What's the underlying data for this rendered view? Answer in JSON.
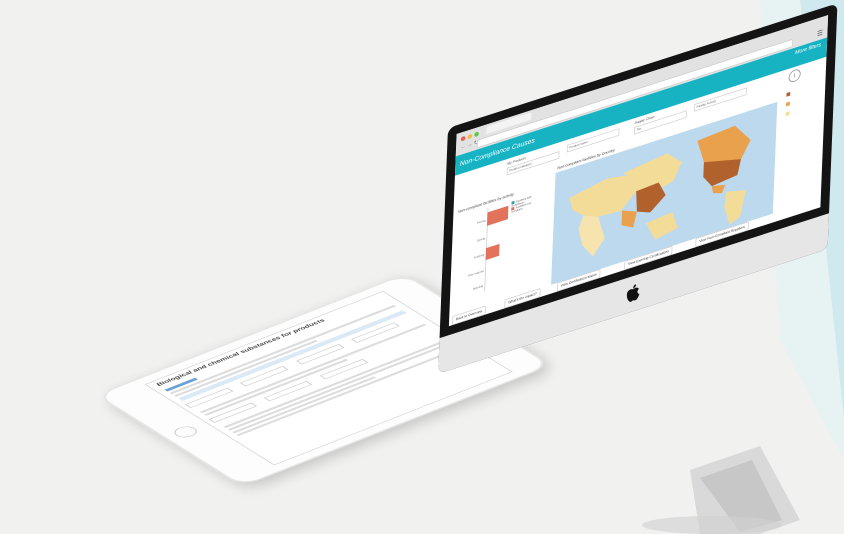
{
  "colors": {
    "accent_teal": "#18b3c2",
    "bar_fill": "#e2735a",
    "map_water": "#bcd9ee",
    "map_high": "#b0612c",
    "map_mid": "#e9a14e",
    "map_low": "#f3dc98",
    "page_background": "#f1f1f0"
  },
  "browser": {
    "back_icon": "back-arrow-icon",
    "forward_icon": "forward-arrow-icon",
    "reload_icon": "reload-icon",
    "menu_icon": "hamburger-menu-icon"
  },
  "app": {
    "title": "Non-Compliance Causes",
    "more_filters": "More filters"
  },
  "filters": [
    {
      "label": "My Products",
      "value": "Product category"
    },
    {
      "label": "",
      "value": "Product name"
    },
    {
      "label": "Supply Chain",
      "value": "Tier"
    },
    {
      "label": "",
      "value": "Facility Activity"
    }
  ],
  "left_panel": {
    "title": "Non-compliant facilities by activity"
  },
  "bar_chart": {
    "categories": [
      "Sewing",
      "Dyeing",
      "Finishing",
      "Raw material",
      "Spinning"
    ],
    "values": [
      48,
      0,
      0,
      32,
      0
    ]
  },
  "legend": [
    {
      "text": "Facilities with compliance",
      "color": "#2fa39a"
    },
    {
      "text": "Facilities non-compliant",
      "color": "#e2735a"
    }
  ],
  "map": {
    "title": "Non-compliant facilities by Country"
  },
  "actions": [
    {
      "label": "Back to Overview"
    },
    {
      "label": "What's the impact?"
    },
    {
      "label": "View Certification status"
    },
    {
      "label": "View Expiring Certifications"
    },
    {
      "label": "View Non-Compliant Suppliers"
    }
  ],
  "tablet": {
    "title": "Biological and chemical substances for products"
  }
}
